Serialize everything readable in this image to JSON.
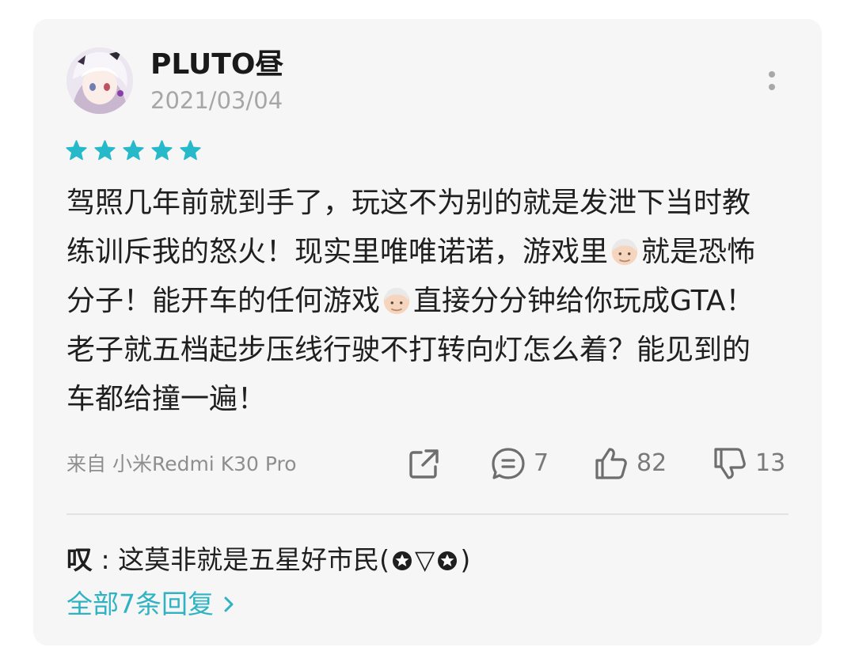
{
  "review": {
    "username": "PLUTO昼",
    "date": "2021/03/04",
    "rating": 5,
    "text_lines": [
      [
        "驾照几年前就到手了，玩这不为别的就是发泄下当时教"
      ],
      [
        "练训斥我的怒火！现实里唯唯诺诺，游戏里",
        "就是恐怖"
      ],
      [
        "分子！能开车的任何游戏",
        "直接分分钟给你玩成GTA！"
      ],
      [
        "老子就五档起步压线行驶不打转向灯怎么着？能见到的"
      ],
      [
        "车都给撞一遍！"
      ]
    ],
    "device": "来自 小米Redmi K30 Pro",
    "comments_count": "7",
    "likes_count": "82",
    "dislikes_count": "13"
  },
  "reply": {
    "author": "叹",
    "separator": " : ",
    "text_before": "这莫非就是五星好市民(",
    "text_middle": "▽",
    "text_after": ")"
  },
  "all_replies_label": "全部7条回复",
  "colors": {
    "accent": "#2fb3c2",
    "star": "#26b9c9",
    "card_bg": "#f6f6f7"
  },
  "icons": [
    "more-icon",
    "star-icon",
    "old-man-emoji",
    "share-icon",
    "comment-icon",
    "thumbs-up-icon",
    "thumbs-down-icon",
    "chevron-right-icon"
  ]
}
